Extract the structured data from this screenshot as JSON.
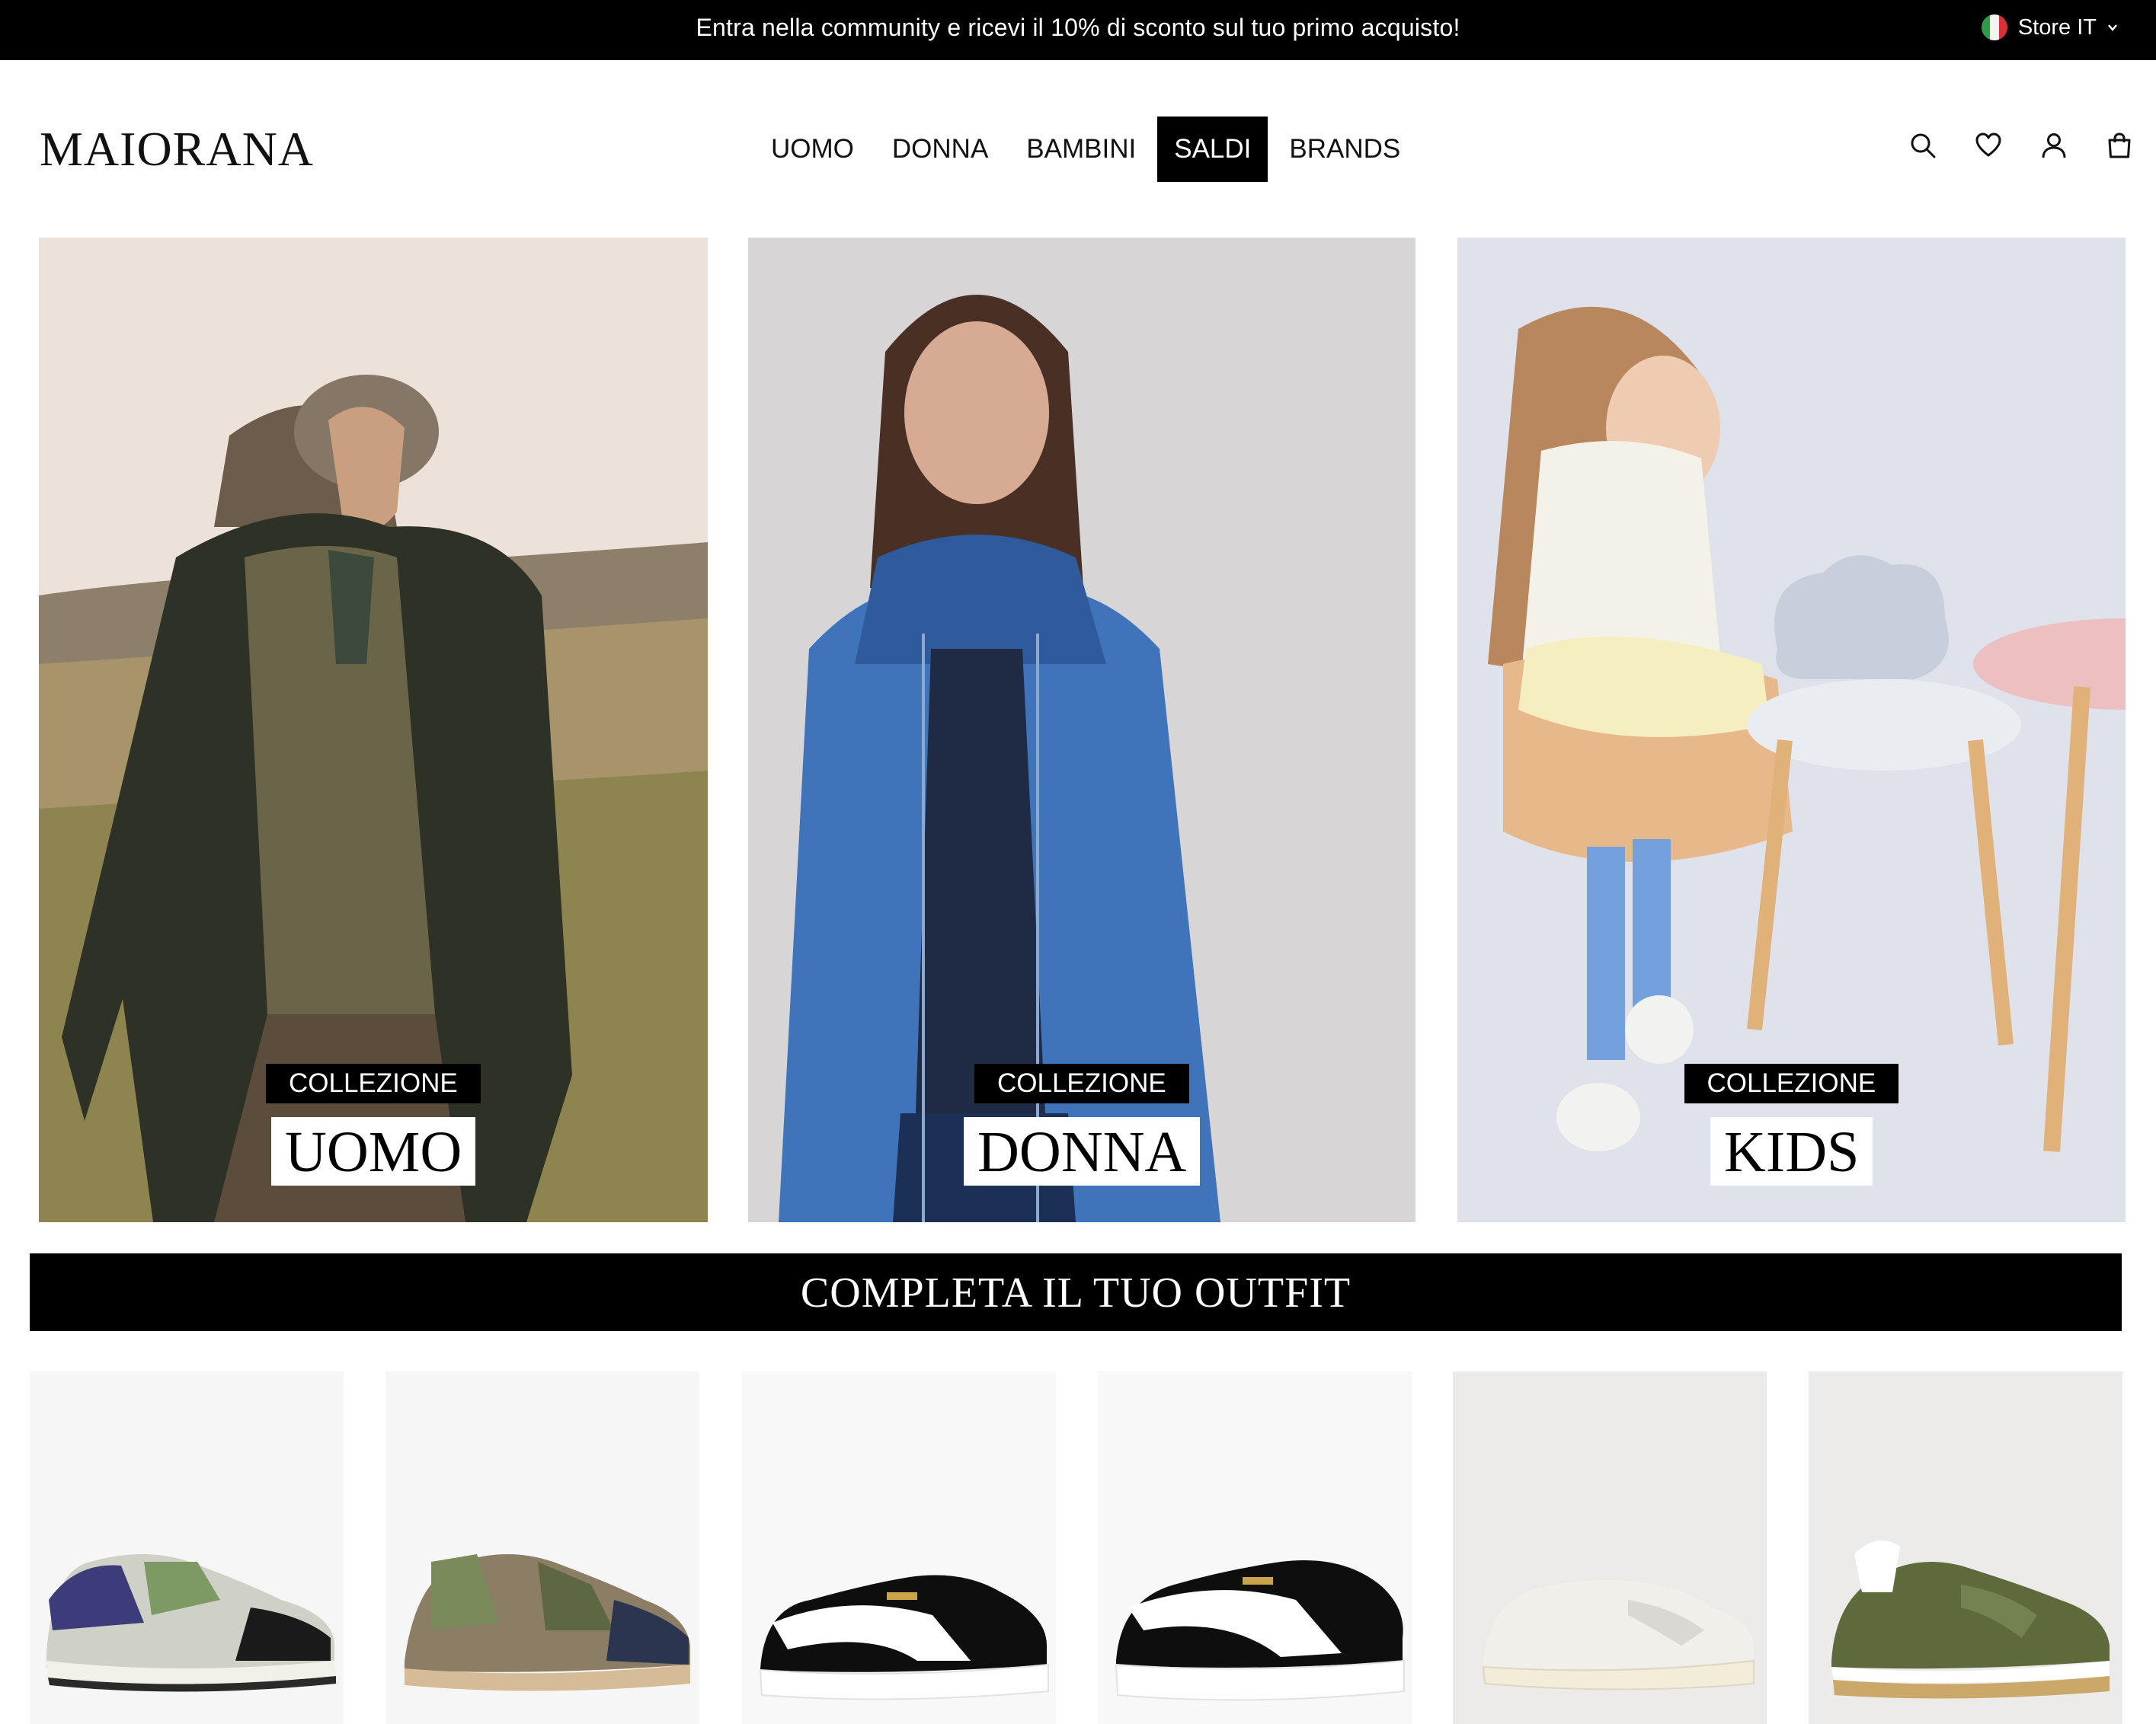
{
  "promo": {
    "text": "Entra nella community e ricevi il 10% di sconto sul tuo primo acquisto!"
  },
  "store": {
    "label": "Store IT",
    "flag_colors": [
      "#2e9c49",
      "#f4f4f4",
      "#d6323a"
    ]
  },
  "brand": {
    "logo": "MAIORANA"
  },
  "nav": [
    {
      "label": "UOMO",
      "active": false
    },
    {
      "label": "DONNA",
      "active": false
    },
    {
      "label": "BAMBINI",
      "active": false
    },
    {
      "label": "SALDI",
      "active": true
    },
    {
      "label": "BRANDS",
      "active": false
    }
  ],
  "header_icons": [
    "search-icon",
    "heart-icon",
    "account-icon",
    "bag-icon"
  ],
  "collections": [
    {
      "small": "COLLEZIONE",
      "big": "UOMO"
    },
    {
      "small": "COLLEZIONE",
      "big": "DONNA"
    },
    {
      "small": "COLLEZIONE",
      "big": "KIDS"
    }
  ],
  "outfit": {
    "title": "COMPLETA IL TUO OUTFIT"
  },
  "colors": {
    "accent": "#000000",
    "background": "#ffffff"
  }
}
